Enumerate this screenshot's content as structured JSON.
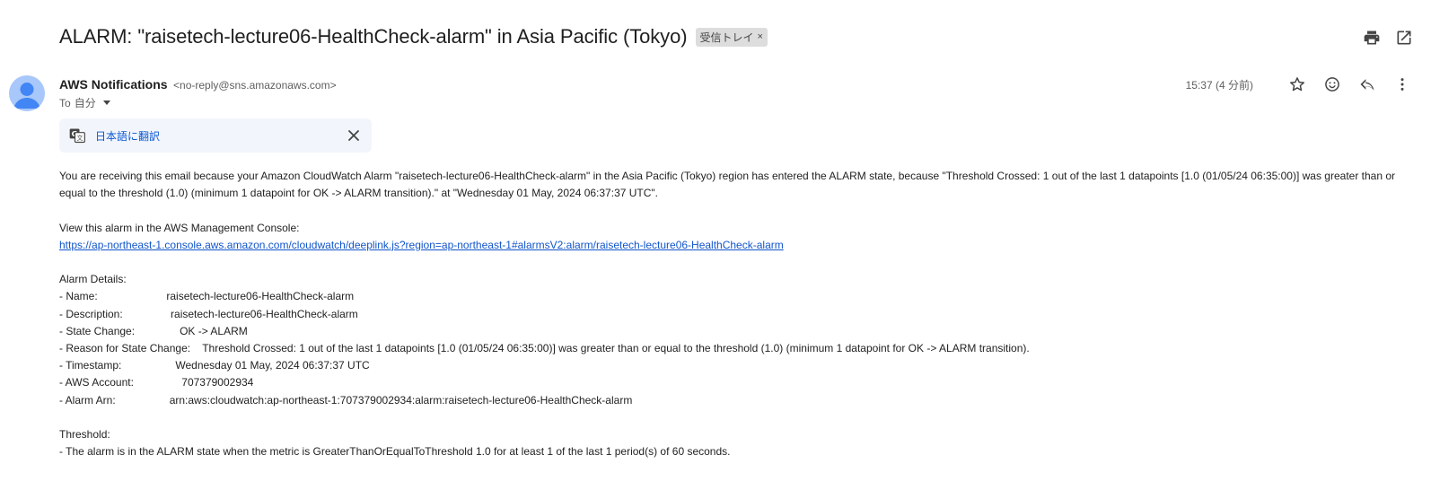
{
  "email": {
    "subject": "ALARM: \"raisetech-lecture06-HealthCheck-alarm\" in Asia Pacific (Tokyo)",
    "label_chip": "受信トレイ",
    "label_remove": "×",
    "sender_name": "AWS Notifications",
    "sender_email": "<no-reply@sns.amazonaws.com>",
    "to_prefix": "To",
    "to_recipient": "自分",
    "timestamp": "15:37 (4 分前)",
    "translate_link": "日本語に翻訳",
    "body": {
      "intro": "You are receiving this email because your Amazon CloudWatch Alarm \"raisetech-lecture06-HealthCheck-alarm\" in the Asia Pacific (Tokyo) region has entered the ALARM state, because \"Threshold Crossed: 1 out of the last 1 datapoints [1.0 (01/05/24 06:35:00)] was greater than or equal to the threshold (1.0) (minimum 1 datapoint for OK -> ALARM transition).\" at \"Wednesday 01 May, 2024 06:37:37 UTC\".",
      "console_label": "View this alarm in the AWS Management Console:",
      "console_link": "https://ap-northeast-1.console.aws.amazon.com/cloudwatch/deeplink.js?region=ap-northeast-1#alarmsV2:alarm/raisetech-lecture06-HealthCheck-alarm",
      "details_heading": "Alarm Details:",
      "details": [
        "- Name:                       raisetech-lecture06-HealthCheck-alarm",
        "- Description:                raisetech-lecture06-HealthCheck-alarm",
        "- State Change:               OK -> ALARM",
        "- Reason for State Change:    Threshold Crossed: 1 out of the last 1 datapoints [1.0 (01/05/24 06:35:00)] was greater than or equal to the threshold (1.0) (minimum 1 datapoint for OK -> ALARM transition).",
        "- Timestamp:                  Wednesday 01 May, 2024 06:37:37 UTC",
        "- AWS Account:                707379002934",
        "- Alarm Arn:                  arn:aws:cloudwatch:ap-northeast-1:707379002934:alarm:raisetech-lecture06-HealthCheck-alarm"
      ],
      "threshold_heading": "Threshold:",
      "threshold_line": "- The alarm is in the ALARM state when the metric is GreaterThanOrEqualToThreshold 1.0 for at least 1 of the last 1 period(s) of 60 seconds."
    }
  },
  "icons": {
    "print": "print-icon",
    "open_new_window": "open-in-new-window-icon",
    "star": "star-icon",
    "emoji": "emoji-reaction-icon",
    "reply": "reply-icon",
    "more": "more-vert-icon",
    "translate": "translate-icon",
    "close": "close-icon",
    "avatar": "default-avatar-icon"
  },
  "colors": {
    "link": "#1155cc",
    "translate_link": "#0b57d0",
    "translate_bg": "#f2f6fc",
    "avatar_bg": "#a8c7fa"
  }
}
